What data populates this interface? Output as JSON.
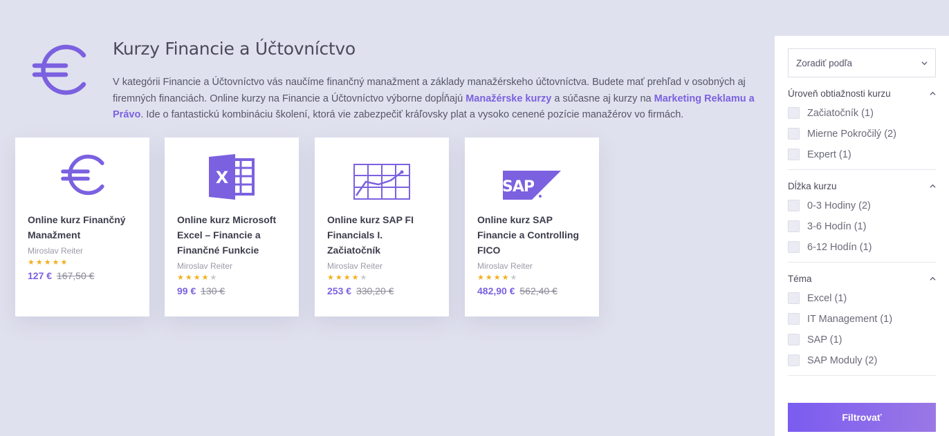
{
  "header": {
    "icon": "euro-icon",
    "title": "Kurzy Financie a Účtovníctvo",
    "desc_part1": "V kategórii Financie a Účtovníctvo vás naučíme finančný manažment a základy manažérskeho účtovníctva. Budete mať prehľad v osobných aj firemných financiách. Online kurzy na Financie a Účtovníctvo výborne dopĺňajú ",
    "link1": "Manažérske kurzy",
    "desc_part2": " a súčasne aj kurzy na ",
    "link2": "Marketing Reklamu a Právo",
    "desc_part3": ". Ide o fantastickú kombináciu školení, ktorá vie zabezpečiť kráľovsky plat a vysoko cenené pozície manažérov vo firmách."
  },
  "cards": [
    {
      "icon": "euro-icon",
      "title": "Online kurz Finančný Manažment",
      "author": "Miroslav Reiter",
      "rating": 5,
      "price": "127 €",
      "old_price": "167,50 €"
    },
    {
      "icon": "excel-icon",
      "title": "Online kurz Microsoft Excel – Financie a Finančné Funkcie",
      "author": "Miroslav Reiter",
      "rating": 4.5,
      "price": "99 €",
      "old_price": "130 €"
    },
    {
      "icon": "sap-fi-chart-icon",
      "title": "Online kurz SAP FI Financials I. Začiatočník",
      "author": "Miroslav Reiter",
      "rating": 4.5,
      "price": "253 €",
      "old_price": "330,20 €"
    },
    {
      "icon": "sap-logo-icon",
      "title": "Online kurz SAP Financie a Controlling FICO",
      "author": "Miroslav Reiter",
      "rating": 4.5,
      "price": "482,90 €",
      "old_price": "562,40 €"
    }
  ],
  "sidebar": {
    "sort_label": "Zoradiť podľa",
    "groups": [
      {
        "title": "Úroveň obtiažnosti kurzu",
        "options": [
          "Začiatočník (1)",
          "Mierne Pokročilý (2)",
          "Expert (1)"
        ]
      },
      {
        "title": "Dĺžka kurzu",
        "options": [
          "0-3 Hodiny (2)",
          "3-6 Hodín (1)",
          "6-12 Hodín (1)"
        ]
      },
      {
        "title": "Téma",
        "options": [
          "Excel (1)",
          "IT Management (1)",
          "SAP (1)",
          "SAP Moduly (2)"
        ]
      }
    ],
    "filter_button": "Filtrovať"
  },
  "colors": {
    "accent": "#7b61e0",
    "star": "#f2b01e",
    "background": "#e0e1ee"
  }
}
